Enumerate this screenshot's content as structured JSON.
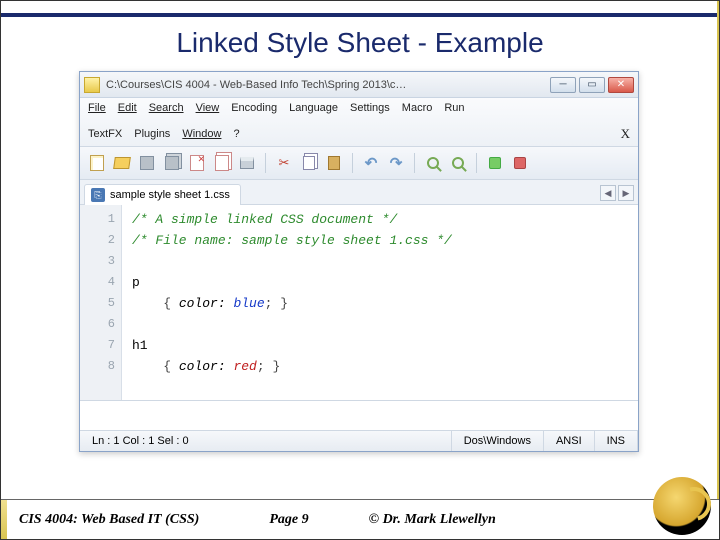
{
  "slide": {
    "title": "Linked Style Sheet - Example"
  },
  "window": {
    "title": "C:\\Courses\\CIS 4004 - Web-Based Info Tech\\Spring 2013\\c…"
  },
  "menu": {
    "file": "File",
    "edit": "Edit",
    "search": "Search",
    "view": "View",
    "encoding": "Encoding",
    "language": "Language",
    "settings": "Settings",
    "macro": "Macro",
    "run": "Run",
    "textfx": "TextFX",
    "plugins": "Plugins",
    "window": "Window",
    "help": "?",
    "x": "X"
  },
  "tab": {
    "filename": "sample style sheet 1.css"
  },
  "gutter": {
    "l1": "1",
    "l2": "2",
    "l3": "3",
    "l4": "4",
    "l5": "5",
    "l6": "6",
    "l7": "7",
    "l8": "8"
  },
  "code": {
    "line1": "/* A simple linked CSS document */",
    "line2": "/* File name: sample style sheet 1.css */",
    "line3": "",
    "line4_sel": "p",
    "line5_open": "{ ",
    "line5_prop": "color: ",
    "line5_val": "blue",
    "line5_close": "; }",
    "line6": "",
    "line7_sel": "h1",
    "line8_open": "{ ",
    "line8_prop": "color: ",
    "line8_val": "red",
    "line8_close": "; }"
  },
  "status": {
    "pos": "Ln : 1    Col : 1    Sel : 0",
    "eol": "Dos\\Windows",
    "enc": "ANSI",
    "mode": "INS"
  },
  "footer": {
    "left": "CIS 4004: Web Based IT (CSS)",
    "mid": "Page 9",
    "right": "© Dr. Mark Llewellyn"
  }
}
